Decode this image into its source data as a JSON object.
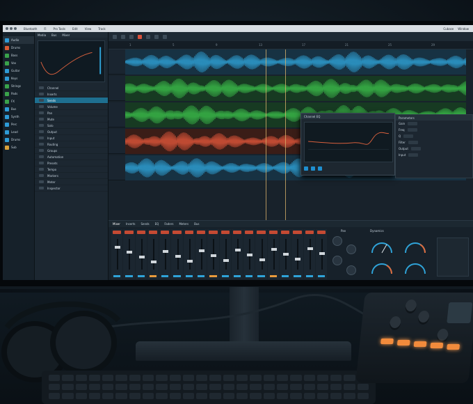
{
  "menubar": {
    "items": [
      "Bluetooth",
      "Fi",
      "Pro Tools",
      "Edit",
      "View",
      "Track"
    ],
    "right": [
      "Cubase",
      "Window"
    ]
  },
  "tracklist": {
    "items": [
      {
        "label": "Audio",
        "color": "#2e9bd6"
      },
      {
        "label": "Drums",
        "color": "#d95c34"
      },
      {
        "label": "Bass",
        "color": "#3aa24a"
      },
      {
        "label": "Vox",
        "color": "#3aa24a"
      },
      {
        "label": "Guitar",
        "color": "#2e9bd6"
      },
      {
        "label": "Keys",
        "color": "#2e9bd6"
      },
      {
        "label": "Strings",
        "color": "#3aa24a"
      },
      {
        "label": "Pads",
        "color": "#3aa24a"
      },
      {
        "label": "FX",
        "color": "#3aa24a"
      },
      {
        "label": "Bus",
        "color": "#2e9bd6"
      },
      {
        "label": "Synth",
        "color": "#2e9bd6"
      },
      {
        "label": "Perc",
        "color": "#2e9bd6"
      },
      {
        "label": "Lead",
        "color": "#2e9bd6"
      },
      {
        "label": "Drums",
        "color": "#2e9bd6"
      },
      {
        "label": "Sub",
        "color": "#d9a13a"
      }
    ]
  },
  "browser": {
    "tabs": [
      "Media",
      "Bus",
      "Mixer"
    ],
    "graph_label": "EQ",
    "rows": [
      {
        "label": "Channel",
        "val": ""
      },
      {
        "label": "Inserts",
        "val": ""
      },
      {
        "label": "Sends",
        "val": ""
      },
      {
        "label": "Volume",
        "val": ""
      },
      {
        "label": "Pan",
        "val": ""
      },
      {
        "label": "Mute",
        "val": ""
      },
      {
        "label": "Solo",
        "val": ""
      },
      {
        "label": "Output",
        "val": ""
      },
      {
        "label": "Input",
        "val": ""
      },
      {
        "label": "Routing",
        "val": ""
      },
      {
        "label": "Groups",
        "val": ""
      },
      {
        "label": "Automation",
        "val": ""
      },
      {
        "label": "Presets",
        "val": ""
      },
      {
        "label": "Tempo",
        "val": ""
      },
      {
        "label": "Markers",
        "val": ""
      },
      {
        "label": "Meter",
        "val": ""
      },
      {
        "label": "Inspector",
        "val": ""
      }
    ]
  },
  "ruler": [
    "1",
    "5",
    "9",
    "13",
    "17",
    "21",
    "25",
    "29"
  ],
  "plugin": {
    "title": "Channel EQ"
  },
  "inspector": {
    "title": "Parameters",
    "rows": [
      "Gain",
      "Freq",
      "Q",
      "Filter",
      "Output",
      "Input"
    ]
  },
  "mixer": {
    "tabs": [
      "Mixer",
      "Inserts",
      "Sends",
      "EQ",
      "Faders",
      "Meters",
      "Bus"
    ],
    "channel_count": 18,
    "knob_label": "Pan",
    "meters_label": "Dynamics"
  }
}
